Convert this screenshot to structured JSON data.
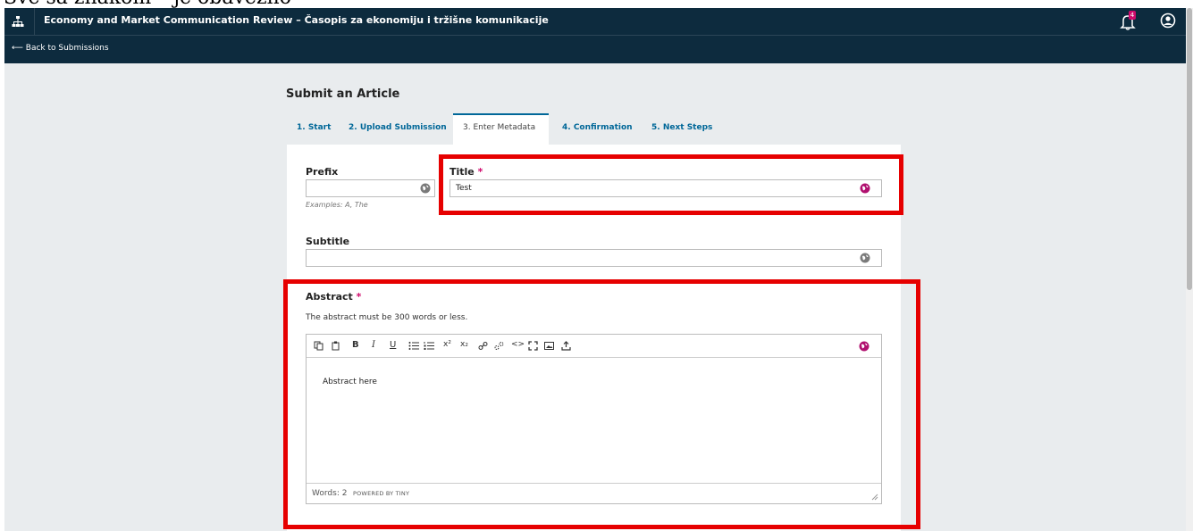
{
  "caption": "Sve sa znakom * je obavezno",
  "header": {
    "site_title": "Economy and Market Communication Review – Časopis za ekonomiju i tržišne komunikacije",
    "notification_count": "4",
    "back_link": "⟵ Back to Submissions"
  },
  "page": {
    "heading": "Submit an Article",
    "tabs": [
      {
        "label": "1. Start"
      },
      {
        "label": "2. Upload Submission"
      },
      {
        "label": "3. Enter Metadata"
      },
      {
        "label": "4. Confirmation"
      },
      {
        "label": "5. Next Steps"
      }
    ],
    "active_tab": "3. Enter Metadata"
  },
  "form": {
    "prefix": {
      "label": "Prefix",
      "value": "",
      "hint": "Examples: A, The"
    },
    "title": {
      "label": "Title",
      "required_mark": "*",
      "value": "Test"
    },
    "subtitle": {
      "label": "Subtitle",
      "value": ""
    },
    "abstract": {
      "label": "Abstract",
      "required_mark": "*",
      "description": "The abstract must be 300 words or less.",
      "content": "Abstract here",
      "word_count": "Words: 2",
      "powered_by": "POWERED BY TINY"
    }
  },
  "toolbar_icons": [
    "copy-icon",
    "paste-icon",
    "bold-icon",
    "italic-icon",
    "underline-icon",
    "bullet-list-icon",
    "numbered-list-icon",
    "superscript-icon",
    "subscript-icon",
    "link-icon",
    "unlink-icon",
    "code-icon",
    "fullscreen-icon",
    "image-icon",
    "upload-icon"
  ],
  "toolbar_glyphs": {
    "bold": "B",
    "italic": "I",
    "underline": "U",
    "superscript": "x²",
    "subscript": "x₂",
    "code": "<>"
  },
  "colors": {
    "header_bg": "#0d2b3e",
    "accent": "#006798",
    "required": "#d00a6c",
    "highlight": "#e60000",
    "page_bg": "#e9ecee"
  }
}
